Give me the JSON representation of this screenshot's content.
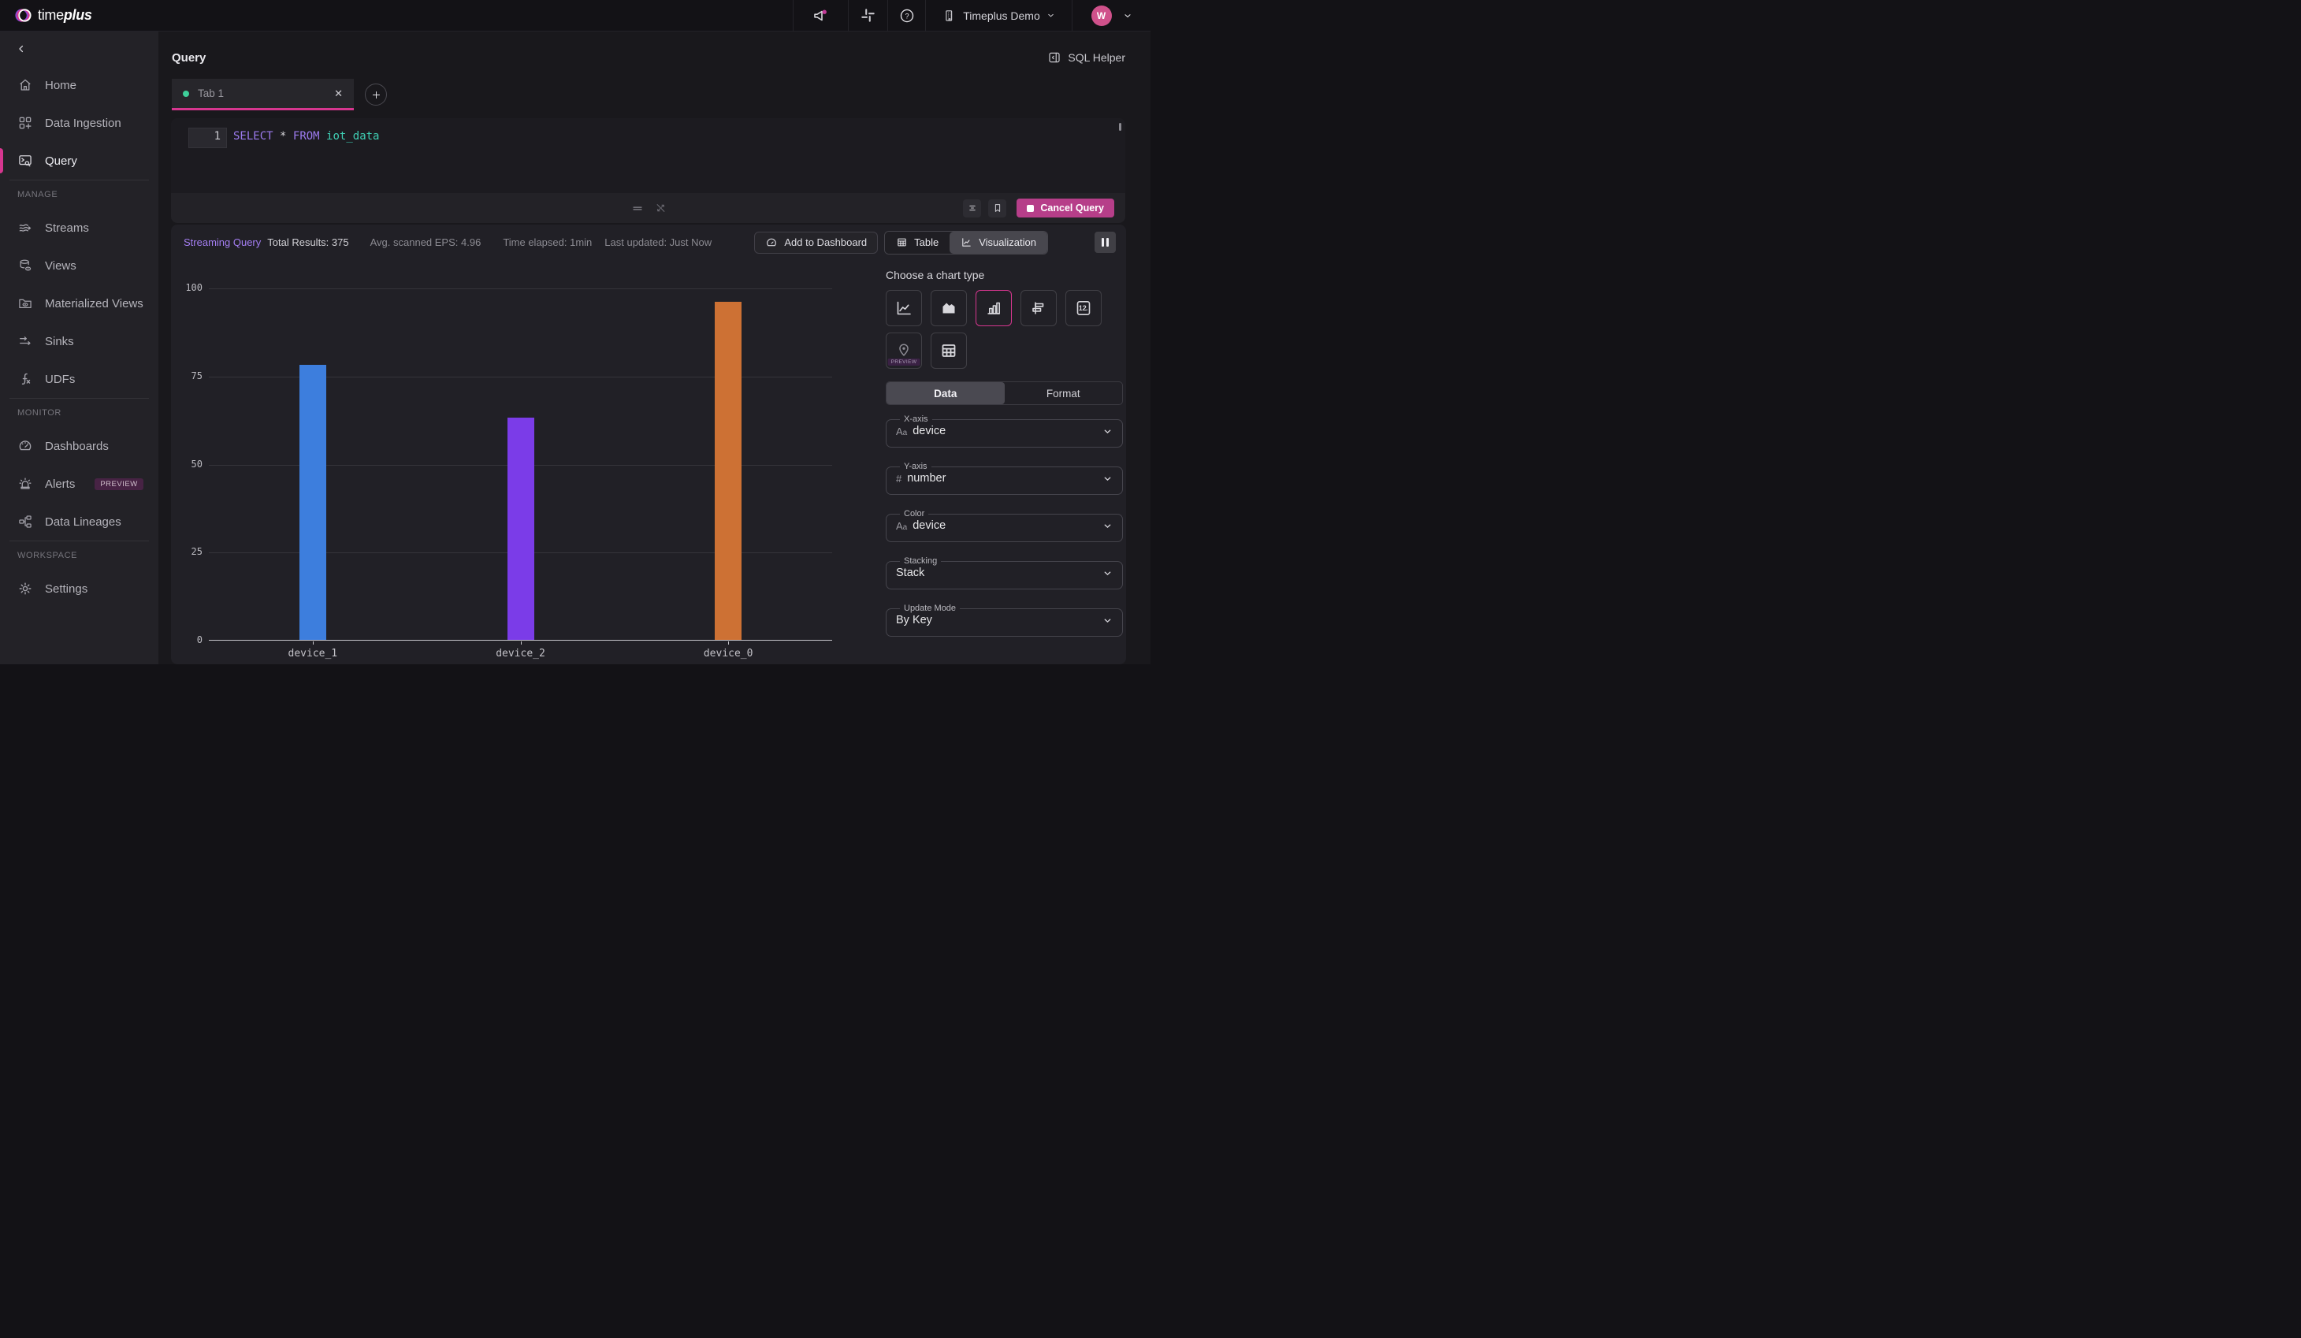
{
  "topbar": {
    "brand_time": "time",
    "brand_plus": "plus",
    "workspace_name": "Timeplus Demo",
    "avatar_initial": "W"
  },
  "page": {
    "title": "Query",
    "sql_helper": "SQL Helper"
  },
  "tabs": {
    "tab1": "Tab 1"
  },
  "editor": {
    "line_number": "1",
    "kw_select": "SELECT",
    "star": "*",
    "kw_from": "FROM",
    "table_name": "iot_data"
  },
  "statusbar": {
    "streaming": "Streaming Query",
    "total_results": "Total Results: 375",
    "eps": "Avg. scanned EPS: 4.96",
    "elapsed": "Time elapsed: 1min",
    "updated": "Last updated: Just Now"
  },
  "actions": {
    "add_to_dashboard": "Add to Dashboard",
    "table": "Table",
    "visualization": "Visualization",
    "cancel_query": "Cancel Query"
  },
  "sidebar": {
    "items": [
      {
        "label": "Home"
      },
      {
        "label": "Data Ingestion"
      },
      {
        "label": "Query"
      }
    ],
    "section_manage": "MANAGE",
    "manage": [
      "Streams",
      "Views",
      "Materialized Views",
      "Sinks",
      "UDFs"
    ],
    "section_monitor": "MONITOR",
    "monitor": [
      "Dashboards",
      "Alerts",
      "Data Lineages"
    ],
    "alerts_badge": "PREVIEW",
    "section_workspace": "WORKSPACE",
    "workspace": [
      "Settings"
    ]
  },
  "viz_panel": {
    "title": "Choose a chart type",
    "map_badge": "PREVIEW",
    "tab_data": "Data",
    "tab_format": "Format",
    "single_value_icon_text": "12",
    "fields": [
      {
        "label": "X-axis",
        "prefix": "Aa",
        "value": "device"
      },
      {
        "label": "Y-axis",
        "prefix": "#",
        "value": "number"
      },
      {
        "label": "Color",
        "prefix": "Aa",
        "value": "device"
      },
      {
        "label": "Stacking",
        "prefix": "",
        "value": "Stack"
      },
      {
        "label": "Update Mode",
        "prefix": "",
        "value": "By Key"
      }
    ]
  },
  "colors": {
    "accent_pink": "#d6368f",
    "cancel_button": "#b63e89",
    "tab_dot_green": "#3ecf9a",
    "keyword_purple": "#9d7bf0",
    "identifier_teal": "#3fcfb4",
    "streaming_purple": "#a47ef2"
  },
  "chart_data": {
    "type": "bar",
    "categories": [
      "device_1",
      "device_2",
      "device_0"
    ],
    "values": [
      78,
      63,
      96
    ],
    "bar_colors": [
      "#3d7edd",
      "#7b3ce8",
      "#cd7134"
    ],
    "title": "",
    "xlabel": "device",
    "ylabel": "number",
    "ylim": [
      0,
      100
    ],
    "yticks": [
      0,
      25,
      50,
      75,
      100
    ],
    "grid": true,
    "legend": false
  }
}
